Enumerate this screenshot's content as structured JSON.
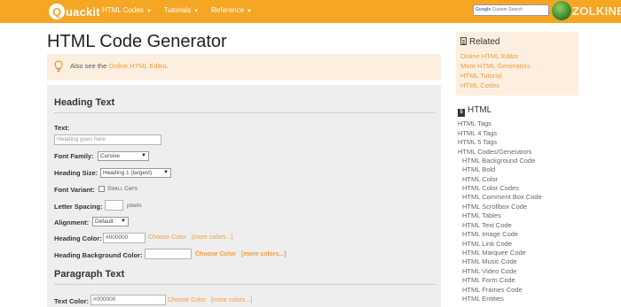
{
  "colors": {
    "accent": "#f5a623",
    "link": "#f39c3a",
    "tip_bg": "#fcefdf",
    "panel_bg": "#eeeeee"
  },
  "header": {
    "logo_letter": "Q",
    "logo_text": "uackit",
    "nav": [
      {
        "label": "HTML Codes"
      },
      {
        "label": "Tutorials"
      },
      {
        "label": "Reference"
      }
    ],
    "search_brand": "Google",
    "search_placeholder": "Custom Search",
    "brand2": "ZOLKINET"
  },
  "page": {
    "title": "HTML Code Generator",
    "tip_prefix": "Also see the ",
    "tip_link": "Online HTML Editor",
    "tip_suffix": "."
  },
  "heading_section": {
    "title": "Heading Text",
    "text_label": "Text:",
    "text_placeholder": "Heading goes here",
    "font_family_label": "Font Family:",
    "font_family_value": "Cursive",
    "heading_size_label": "Heading Size:",
    "heading_size_value": "Heading 1 (largest)",
    "font_variant_label": "Font Variant:",
    "font_variant_option": "Small Caps",
    "letter_spacing_label": "Letter Spacing:",
    "letter_spacing_unit": "pixels",
    "alignment_label": "Alignment:",
    "alignment_value": "Default",
    "heading_color_label": "Heading Color:",
    "heading_color_value": "#000000",
    "choose_color": "Choose Color",
    "more_colors": "[more colors...]",
    "bg_color_label": "Heading Background Color:",
    "bg_choose_color": "Choose Color",
    "bg_more_colors": "[more colors...]"
  },
  "paragraph_section": {
    "title": "Paragraph Text",
    "text_color_label": "Text Color:",
    "text_color_value": "#000000",
    "choose_color": "Choose Color",
    "more_colors": "[more colors...]"
  },
  "sidebar": {
    "related_title": "Related",
    "related_links": [
      "Online HTML Editor",
      "More HTML Generators",
      "HTML Tutorial",
      "HTML Codes"
    ],
    "html_title": "HTML",
    "html_links": [
      "HTML Tags",
      "HTML 4 Tags",
      "HTML 5 Tags",
      "HTML Codes/Generators"
    ],
    "code_links": [
      "HTML Background Code",
      "HTML Bold",
      "HTML Color",
      "HTML Color Codes",
      "HTML Comment Box Code",
      "HTML Scrollbox Code",
      "HTML Tables",
      "HTML Text Code",
      "HTML Image Code",
      "HTML Link Code",
      "HTML Marquee Code",
      "HTML Music Code",
      "HTML Video Code",
      "HTML Form Code",
      "HTML Frames Code",
      "HTML Entities"
    ]
  }
}
